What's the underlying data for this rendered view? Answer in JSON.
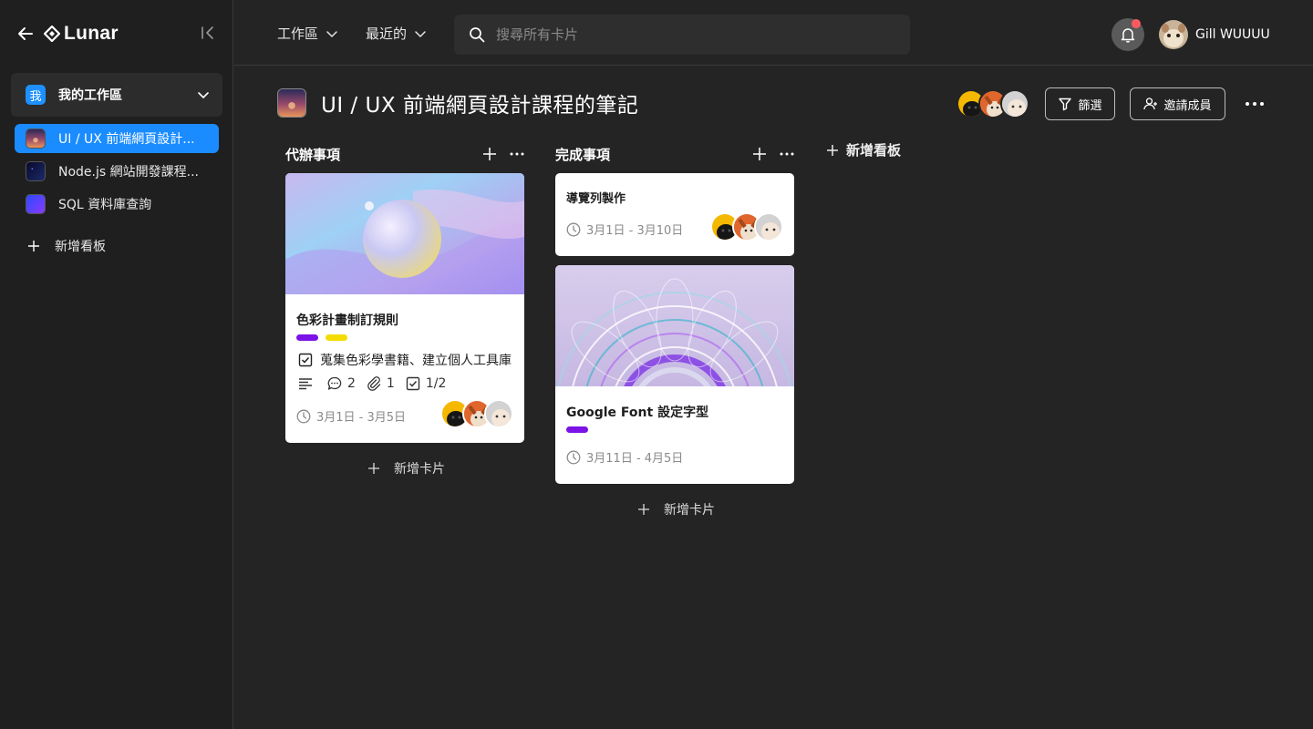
{
  "app": {
    "name": "Lunar"
  },
  "sidebar": {
    "workspace": {
      "badge": "我",
      "label": "我的工作區"
    },
    "boards": [
      {
        "label": "UI / UX 前端網頁設計..."
      },
      {
        "label": "Node.js 網站開發課程..."
      },
      {
        "label": "SQL 資料庫查詢"
      }
    ],
    "add_board": "新增看板"
  },
  "topbar": {
    "menu_workspace": "工作區",
    "menu_recent": "最近的",
    "search_placeholder": "搜尋所有卡片",
    "user_name": "Gill WUUUU"
  },
  "board": {
    "title": "UI / UX 前端網頁設計課程的筆記",
    "filter_label": "篩選",
    "invite_label": "邀請成員",
    "add_list": "新增看板"
  },
  "lists": [
    {
      "title": "代辦事項",
      "add_card": "新增卡片",
      "cards": [
        {
          "title": "色彩計畫制訂規則",
          "tags": [
            "#7b12e6",
            "#f5dc00"
          ],
          "checklist_item": "蒐集色彩學書籍、建立個人工具庫",
          "comments": "2",
          "attachments": "1",
          "checklist": "1/2",
          "date": "3月1日 - 3月5日"
        }
      ]
    },
    {
      "title": "完成事項",
      "add_card": "新增卡片",
      "cards": [
        {
          "title": "導覽列製作",
          "date": "3月1日 - 3月10日"
        },
        {
          "title": "Google Font 設定字型",
          "tags": [
            "#7b12e6"
          ],
          "date": "3月11日 - 4月5日"
        }
      ]
    }
  ],
  "colors": {
    "accent": "#1a8cff",
    "background": "#242424",
    "sidebar": "#1f1f1f",
    "notification_dot": "#ff5a5f",
    "tag_purple": "#7b12e6",
    "tag_yellow": "#f5dc00"
  }
}
